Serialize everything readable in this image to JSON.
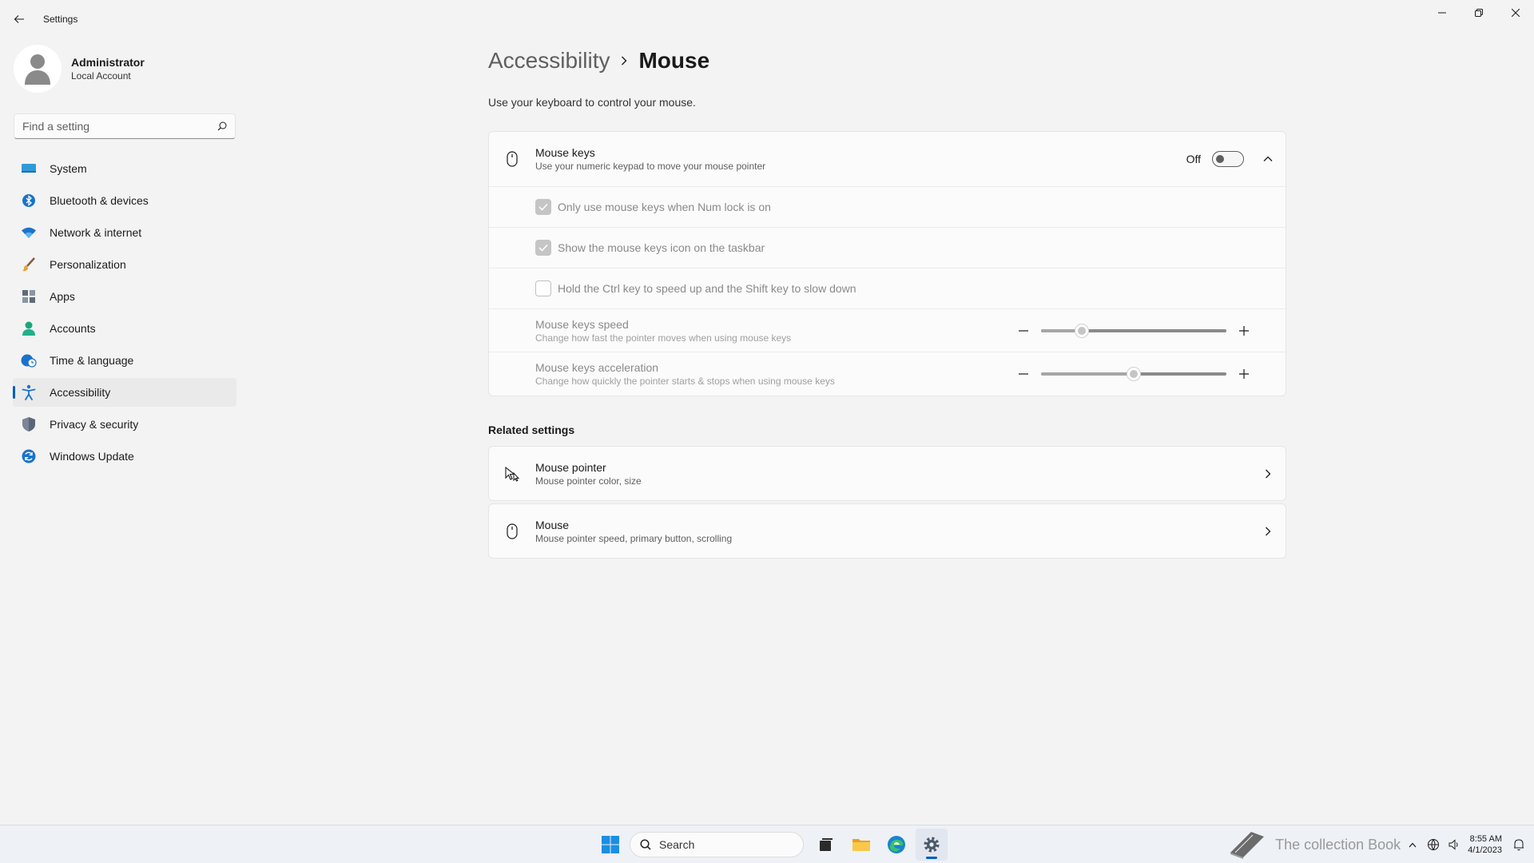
{
  "window": {
    "title": "Settings"
  },
  "profile": {
    "name": "Administrator",
    "account_type": "Local Account"
  },
  "search": {
    "placeholder": "Find a setting"
  },
  "sidebar": {
    "items": [
      {
        "label": "System",
        "icon": "system-icon"
      },
      {
        "label": "Bluetooth & devices",
        "icon": "bluetooth-icon"
      },
      {
        "label": "Network & internet",
        "icon": "wifi-icon"
      },
      {
        "label": "Personalization",
        "icon": "brush-icon"
      },
      {
        "label": "Apps",
        "icon": "apps-icon"
      },
      {
        "label": "Accounts",
        "icon": "accounts-icon"
      },
      {
        "label": "Time & language",
        "icon": "globe-clock-icon"
      },
      {
        "label": "Accessibility",
        "icon": "accessibility-icon",
        "active": true
      },
      {
        "label": "Privacy & security",
        "icon": "shield-icon"
      },
      {
        "label": "Windows Update",
        "icon": "update-icon"
      }
    ]
  },
  "page": {
    "breadcrumb_parent": "Accessibility",
    "breadcrumb_current": "Mouse",
    "description": "Use your keyboard to control your mouse."
  },
  "mouse_keys": {
    "title": "Mouse keys",
    "description": "Use your numeric keypad to move your mouse pointer",
    "toggle_label": "Off",
    "toggle_on": false,
    "options": [
      {
        "label": "Only use mouse keys when Num lock is on",
        "checked": true
      },
      {
        "label": "Show the mouse keys icon on the taskbar",
        "checked": true
      },
      {
        "label": "Hold the Ctrl key to speed up and the Shift key to slow down",
        "checked": false
      }
    ],
    "speed": {
      "title": "Mouse keys speed",
      "description": "Change how fast the pointer moves when using mouse keys",
      "value_fraction": 0.22
    },
    "acceleration": {
      "title": "Mouse keys acceleration",
      "description": "Change how quickly the pointer starts & stops when using mouse keys",
      "value_fraction": 0.5
    }
  },
  "related": {
    "title": "Related settings",
    "items": [
      {
        "title": "Mouse pointer",
        "description": "Mouse pointer color, size"
      },
      {
        "title": "Mouse",
        "description": "Mouse pointer speed, primary button, scrolling"
      }
    ]
  },
  "taskbar": {
    "search_label": "Search",
    "watermark_text": "The collection Book",
    "time": "8:55 AM",
    "date": "4/1/2023"
  },
  "colors": {
    "accent": "#005fb8",
    "background": "#f3f3f3",
    "card": "#fbfbfb"
  }
}
